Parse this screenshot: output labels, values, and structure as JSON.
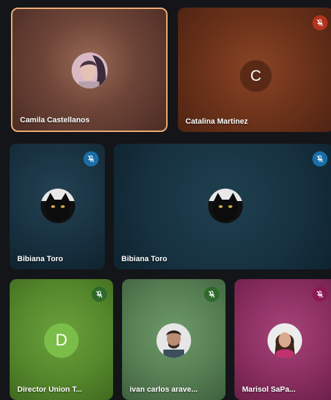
{
  "participants": [
    {
      "name": "Camila Castellanos"
    },
    {
      "name": "Catalina Martinez",
      "initial": "C"
    },
    {
      "name": "Bibiana Toro"
    },
    {
      "name": "Bibiana Toro"
    },
    {
      "name": "Director Union T..."
    },
    {
      "name": "ivan carlos arave..."
    },
    {
      "name": "Marisol SaPa..."
    }
  ],
  "initials": {
    "director": "D"
  },
  "icons": {
    "mic_off": "mic-off-icon"
  },
  "colors": {
    "page_bg": "#141518",
    "active_border": "#f2b27a",
    "mic_red": "#b3341f",
    "mic_blue": "#1a6ea8",
    "mic_green": "#2e6a2a",
    "mic_magenta": "#8c1a55"
  }
}
